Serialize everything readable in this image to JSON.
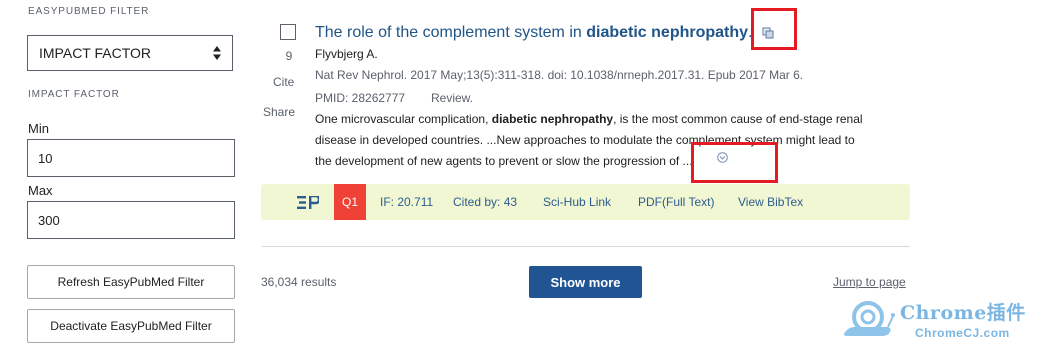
{
  "sidebar": {
    "heading": "EASYPUBMED FILTER",
    "select_value": "IMPACT FACTOR",
    "sub_heading": "IMPACT FACTOR",
    "min_label": "Min",
    "min_value": "10",
    "max_label": "Max",
    "max_value": "300",
    "refresh_button": "Refresh EasyPubMed Filter",
    "deactivate_button": "Deactivate EasyPubMed Filter"
  },
  "article": {
    "number": "9",
    "cite_label": "Cite",
    "share_label": "Share",
    "title_prefix": "The role of the complement system in ",
    "title_bold": "diabetic nephropathy",
    "title_suffix": ".",
    "authors": "Flyvbjerg A.",
    "citation": "Nat Rev Nephrol. 2017 May;13(5):311-318. doi: 10.1038/nrneph.2017.31. Epub 2017 Mar 6.",
    "pmid": "PMID: 28262777",
    "pub_type": "Review.",
    "snippet_line1_pre": "One microvascular complication, ",
    "snippet_line1_bold": "diabetic nephropathy",
    "snippet_line1_post": ", is the most common cause of end-stage renal",
    "snippet_line2": "disease in developed countries. ...New approaches to modulate the complement system might lead to",
    "snippet_line3": "the development of new agents to prevent or slow the progression of ..."
  },
  "easypubmed_bar": {
    "quartile": "Q1",
    "impact_factor": "IF: 20.711",
    "cited_by": "Cited by: 43",
    "scihub": "Sci-Hub Link",
    "pdf": "PDF(Full Text)",
    "bibtex": "View BibTex"
  },
  "footer": {
    "results_count": "36,034 results",
    "show_more": "Show more",
    "jump_to_page": "Jump to page"
  },
  "watermark": {
    "line1": "Chrome插件",
    "line2": "ChromeCJ.com"
  },
  "colors": {
    "link_blue": "#20558a",
    "button_blue": "#205493",
    "highlight_red": "#e41b23",
    "bar_background": "#f1f7d2",
    "q1_red": "#ef4136"
  }
}
